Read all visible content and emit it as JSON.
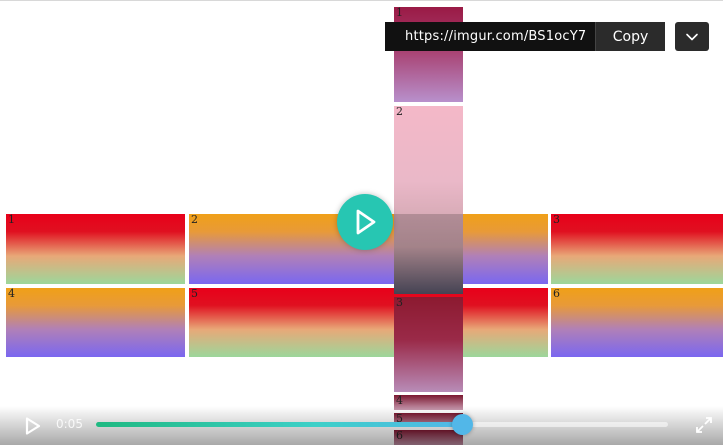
{
  "url_bar": {
    "url": "https://imgur.com/BS1ocY7",
    "copy_label": "Copy"
  },
  "content": {
    "row_labels": [
      "1",
      "2",
      "3",
      "4",
      "5",
      "6"
    ],
    "column_labels": [
      "1",
      "2",
      "3",
      "4",
      "5",
      "6"
    ]
  },
  "player": {
    "time": "0:05",
    "progress": 0.64,
    "colors": {
      "accent": "#27c6b2",
      "progress_start": "#1fb981",
      "progress_end": "#52b7e8"
    }
  },
  "icons": {
    "dropdown": "chevron-down-icon",
    "center_play": "play-icon",
    "small_play": "play-icon",
    "fullscreen": "fullscreen-icon"
  }
}
